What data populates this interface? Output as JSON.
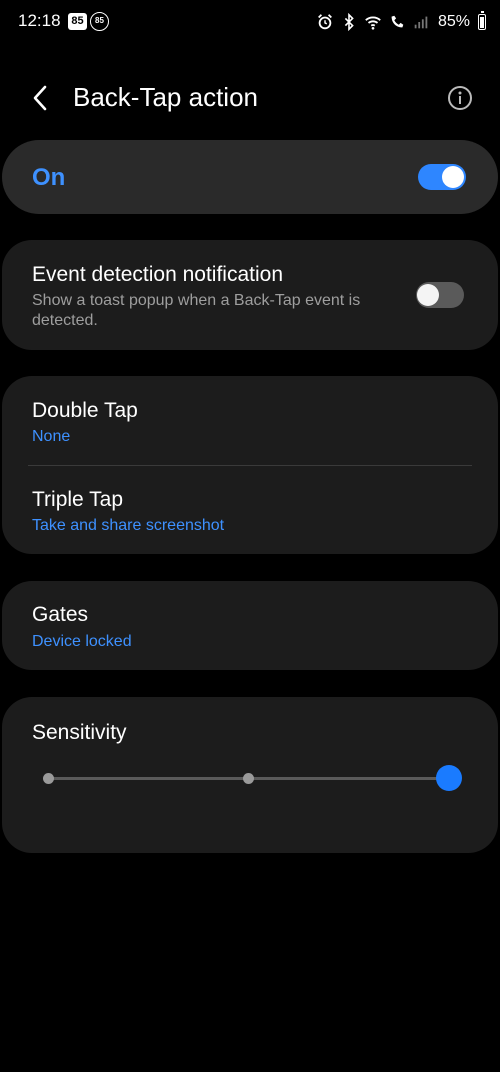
{
  "status_bar": {
    "time": "12:18",
    "notification_badge_1": "85",
    "notification_badge_2": "85",
    "battery_percent": "85%",
    "icons": [
      "alarm-icon",
      "bluetooth-icon",
      "wifi-icon",
      "wifi-calling-icon",
      "signal-icon",
      "battery-icon"
    ]
  },
  "app_bar": {
    "title": "Back-Tap action",
    "back_icon": "chevron-left-icon",
    "info_icon": "info-icon"
  },
  "master_switch": {
    "label": "On",
    "enabled": true
  },
  "event_detection": {
    "title": "Event detection notification",
    "subtitle": "Show a toast popup when a Back-Tap event is detected.",
    "enabled": false
  },
  "taps": [
    {
      "title": "Double Tap",
      "value": "None"
    },
    {
      "title": "Triple Tap",
      "value": "Take and share screenshot"
    }
  ],
  "gates": {
    "title": "Gates",
    "value": "Device locked"
  },
  "sensitivity": {
    "title": "Sensitivity",
    "steps": 3,
    "selected_step": 3
  },
  "colors": {
    "accent": "#3e91ff",
    "card": "#1c1c1c",
    "master_card": "#2a2a2a",
    "background": "#000000"
  }
}
